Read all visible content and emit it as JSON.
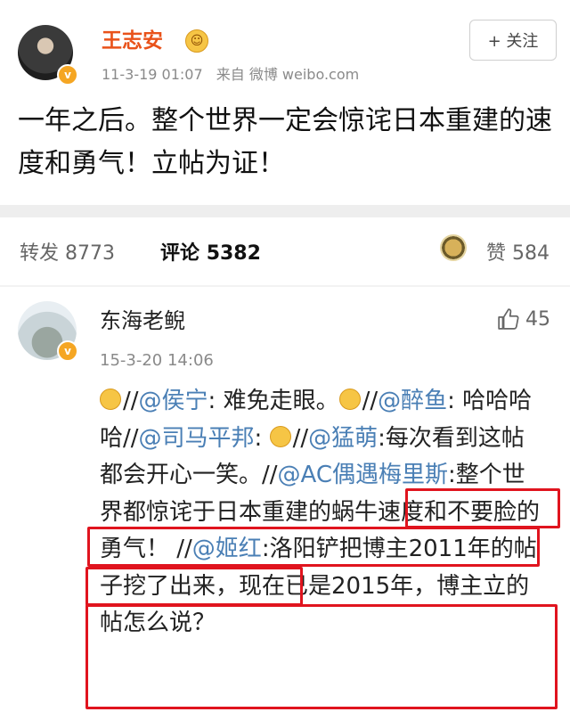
{
  "post": {
    "author": "王志安",
    "timestamp": "11-3-19 01:07",
    "source_prefix": "来自",
    "source": "微博 weibo.com",
    "follow_label": "+ 关注",
    "text": "一年之后。整个世界一定会惊诧日本重建的速度和勇气！立帖为证！"
  },
  "stats": {
    "repost_label": "转发",
    "repost_count": "8773",
    "comment_label": "评论",
    "comment_count": "5382",
    "like_label": "赞",
    "like_count": "584"
  },
  "comment": {
    "author": "东海老鲵",
    "timestamp": "15-3-20 14:06",
    "like_count": "45",
    "segments": [
      {
        "t": "//",
        "m": false
      },
      {
        "t": "@侯宁",
        "m": true
      },
      {
        "t": ": 难免走眼。",
        "m": false
      },
      {
        "t": "//",
        "m": false
      },
      {
        "t": "@醉鱼",
        "m": true
      },
      {
        "t": ": 哈哈哈哈//",
        "m": false
      },
      {
        "t": "@司马平邦",
        "m": true
      },
      {
        "t": ": ",
        "m": false
      },
      {
        "t": "//",
        "m": false
      },
      {
        "t": "@猛萌",
        "m": true
      },
      {
        "t": ":每次看到这帖都会开心一笑。//",
        "m": false
      },
      {
        "t": "@AC偶遇梅里斯",
        "m": true
      },
      {
        "t": ":整个世界都惊诧于日本重建的蜗牛速度和不要脸的勇气！ //",
        "m": false
      },
      {
        "t": "@姬红",
        "m": true
      },
      {
        "t": ":洛阳铲把博主2011年的帖子挖了出来，现在已是2015年，博主立的帖怎么说？",
        "m": false
      }
    ]
  },
  "colors": {
    "author_orange": "#e9521a",
    "mention_blue": "#4a7fb5",
    "highlight_red": "#e0141e",
    "verified_badge": "#f5a623"
  }
}
